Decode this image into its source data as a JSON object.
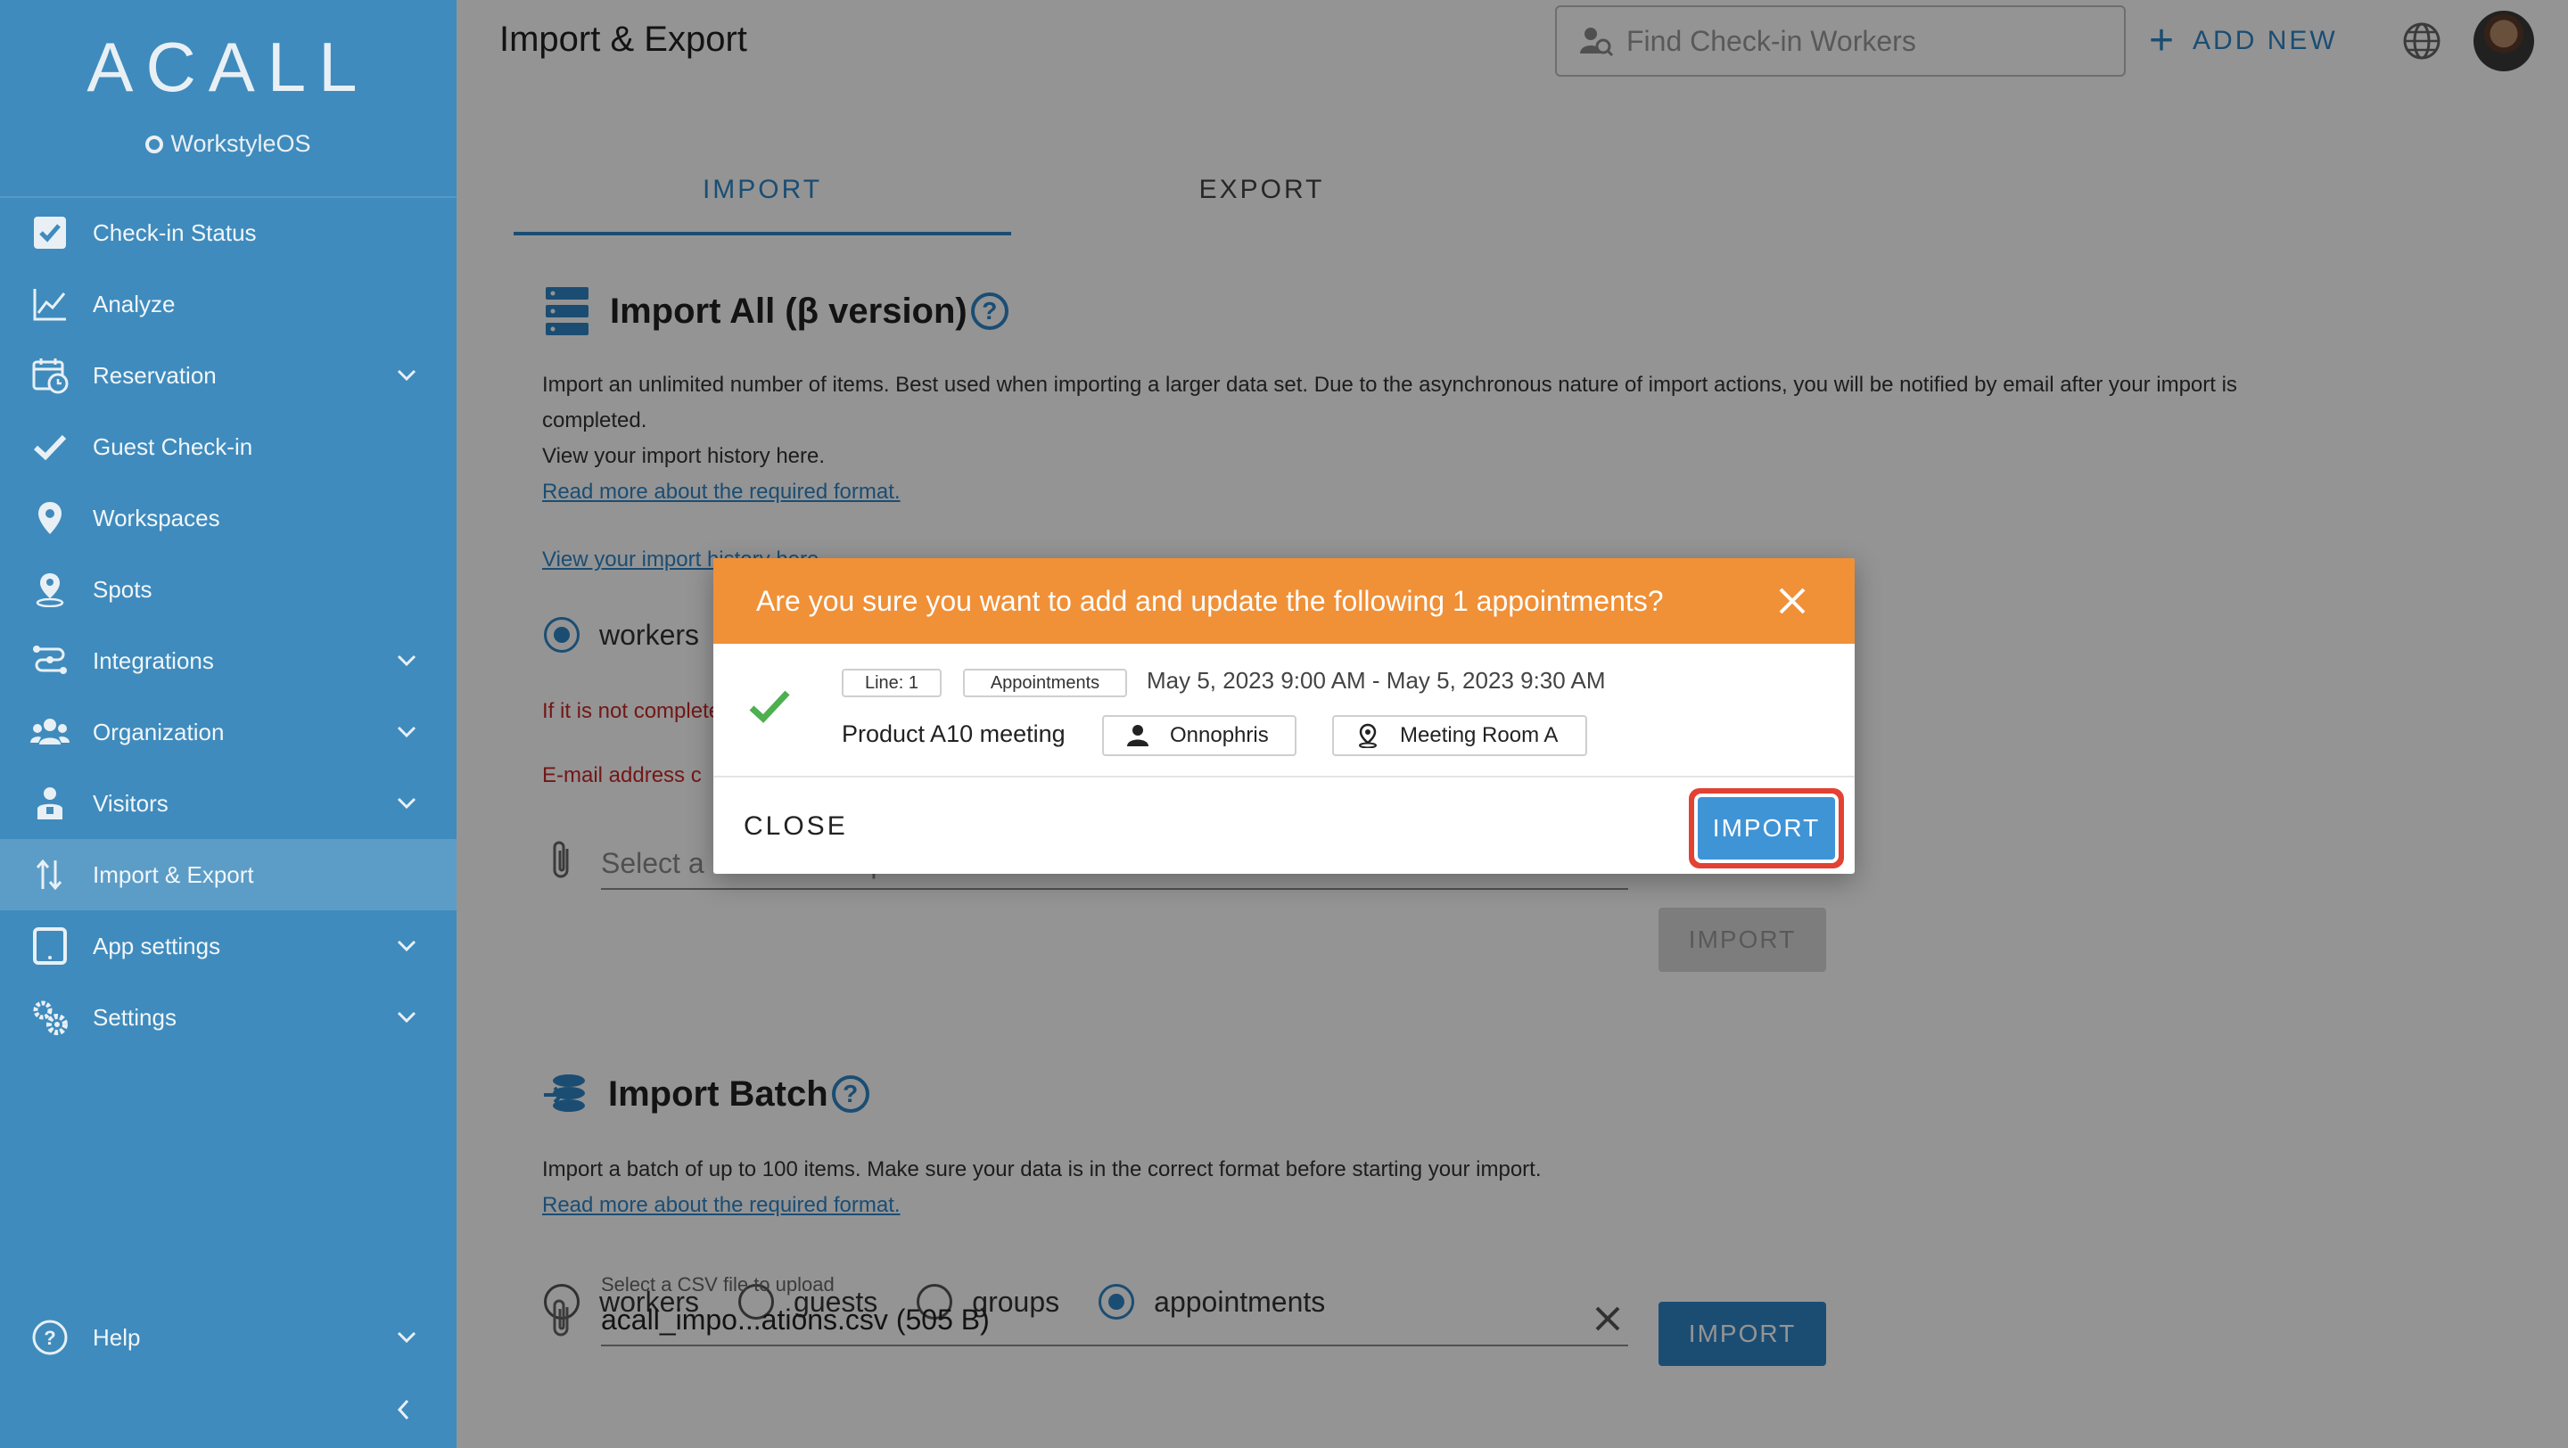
{
  "sidebar": {
    "logo": "ACALL",
    "subbrand": "WorkstyleOS",
    "items": [
      {
        "label": "Check-in Status",
        "icon": "checkbox-icon",
        "chevron": false,
        "active": false
      },
      {
        "label": "Analyze",
        "icon": "line-chart-icon",
        "chevron": false,
        "active": false
      },
      {
        "label": "Reservation",
        "icon": "calendar-clock-icon",
        "chevron": true,
        "active": false
      },
      {
        "label": "Guest Check-in",
        "icon": "checkmark-icon",
        "chevron": false,
        "active": false
      },
      {
        "label": "Workspaces",
        "icon": "map-pin-icon",
        "chevron": false,
        "active": false
      },
      {
        "label": "Spots",
        "icon": "location-person-icon",
        "chevron": false,
        "active": false
      },
      {
        "label": "Integrations",
        "icon": "integrations-icon",
        "chevron": true,
        "active": false
      },
      {
        "label": "Organization",
        "icon": "people-group-icon",
        "chevron": true,
        "active": false
      },
      {
        "label": "Visitors",
        "icon": "visitor-icon",
        "chevron": true,
        "active": false
      },
      {
        "label": "Import & Export",
        "icon": "import-export-arrows-icon",
        "chevron": false,
        "active": true
      },
      {
        "label": "App settings",
        "icon": "tablet-icon",
        "chevron": true,
        "active": false
      },
      {
        "label": "Settings",
        "icon": "gears-icon",
        "chevron": true,
        "active": false
      }
    ],
    "help": {
      "label": "Help",
      "icon": "help-circle-icon"
    }
  },
  "header": {
    "title": "Import & Export",
    "search_placeholder": "Find Check-in Workers",
    "add_new": "ADD NEW"
  },
  "tabs": [
    {
      "label": "IMPORT",
      "active": true
    },
    {
      "label": "EXPORT",
      "active": false
    }
  ],
  "import_all": {
    "title": "Import All (β version)",
    "help": "?",
    "desc_line1": "Import an unlimited number of items. Best used when importing a larger data set. Due to the asynchronous nature of import actions, you will be notified by email after your import is",
    "desc_line2": "completed.",
    "desc_line3": "View your import history here.",
    "format_link": "Read more about the required format.",
    "history_link": "View your import history here.",
    "radio_workers": "workers",
    "error1": "If it is not complete",
    "error2": "E-mail address c",
    "file_placeholder": "Select a CSV file to upload",
    "import_button": "IMPORT"
  },
  "import_batch": {
    "title": "Import Batch",
    "help": "?",
    "desc": "Import a batch of up to 100 items. Make sure your data is in the correct format before starting your import.",
    "format_link": "Read more about the required format.",
    "radios": [
      "workers",
      "guests",
      "groups",
      "appointments"
    ],
    "selected_radio": "appointments",
    "file_label": "Select a CSV file to upload",
    "file_value": "acall_impo...ations.csv (505 B)",
    "import_button": "IMPORT"
  },
  "dialog": {
    "title": "Are you sure you want to add and update the following 1 appointments?",
    "line_chip": "Line: 1",
    "type_chip": "Appointments",
    "time_range": "May 5, 2023 9:00 AM - May 5, 2023 9:30 AM",
    "appointment_title": "Product A10 meeting",
    "host": "Onnophris",
    "room": "Meeting Room A",
    "close_button": "CLOSE",
    "import_button": "IMPORT"
  },
  "colors": {
    "sidebar": "#3f8bbd",
    "accent": "#2f86c7",
    "dialog_header": "#f09037",
    "highlight_outline": "#e24234",
    "error_text": "#c62828"
  }
}
